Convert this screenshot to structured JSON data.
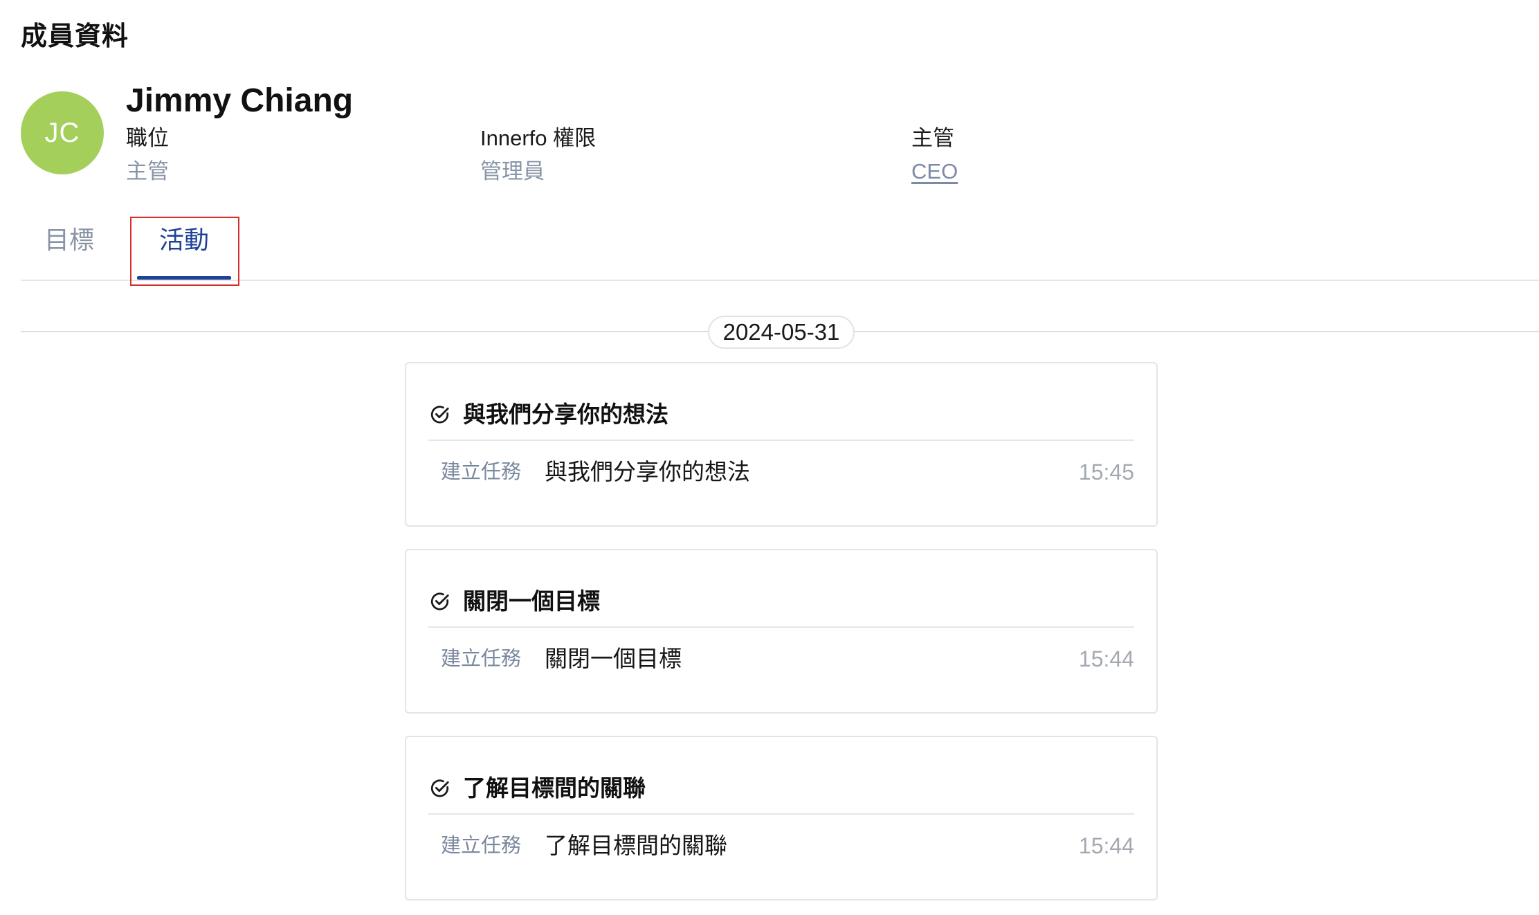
{
  "page": {
    "title": "成員資料"
  },
  "member": {
    "initials": "JC",
    "avatar_color": "#a4cf5b",
    "name": "Jimmy Chiang",
    "fields": [
      {
        "label": "職位",
        "value": "主管"
      },
      {
        "label": "Innerfo 權限",
        "value": "管理員"
      },
      {
        "label": "主管",
        "value": "CEO"
      }
    ]
  },
  "tabs": [
    {
      "label": "目標",
      "active": false
    },
    {
      "label": "活動",
      "active": true
    }
  ],
  "activity": {
    "date": "2024-05-31",
    "items": [
      {
        "title": "與我們分享你的想法",
        "action": "建立任務",
        "content": "與我們分享你的想法",
        "time": "15:45",
        "icon": "check-circle-icon"
      },
      {
        "title": "關閉一個目標",
        "action": "建立任務",
        "content": "關閉一個目標",
        "time": "15:44",
        "icon": "check-circle-icon"
      },
      {
        "title": "了解目標間的關聯",
        "action": "建立任務",
        "content": "了解目標間的關聯",
        "time": "15:44",
        "icon": "check-circle-icon"
      }
    ]
  },
  "colors": {
    "accent": "#1e4296",
    "highlight_box": "#d4302a",
    "muted_text": "#8794a8"
  }
}
